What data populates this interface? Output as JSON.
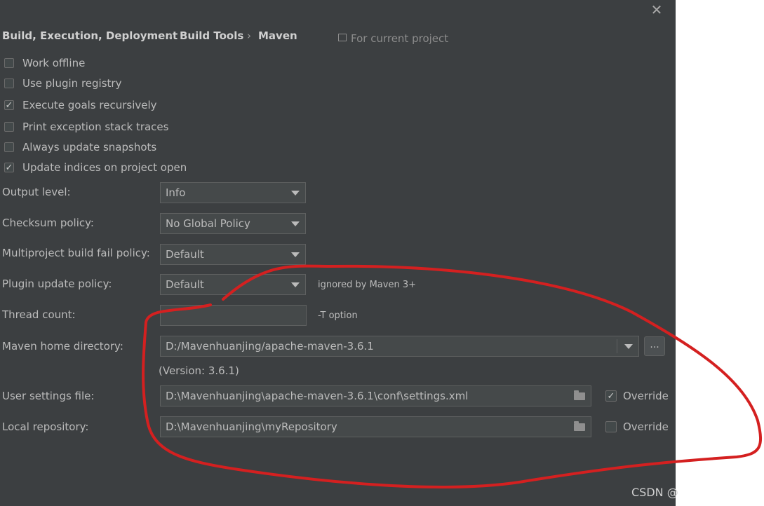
{
  "dialog": {
    "close_glyph": "✕"
  },
  "breadcrumb": {
    "items": [
      "Build, Execution, Deployment",
      "Build Tools",
      "Maven"
    ],
    "separator": "›"
  },
  "scope": {
    "label": "For current project"
  },
  "checkboxes": [
    {
      "label": "Work offline",
      "checked": false
    },
    {
      "label": "Use plugin registry",
      "checked": false
    },
    {
      "label": "Execute goals recursively",
      "checked": true
    },
    {
      "label": "Print exception stack traces",
      "checked": false
    },
    {
      "label": "Always update snapshots",
      "checked": false
    },
    {
      "label": "Update indices on project open",
      "checked": true
    }
  ],
  "settings": {
    "output_level": {
      "label": "Output level:",
      "value": "Info"
    },
    "checksum_policy": {
      "label": "Checksum policy:",
      "value": "No Global Policy"
    },
    "multiproject_policy": {
      "label": "Multiproject build fail policy:",
      "value": "Default"
    },
    "plugin_update_policy": {
      "label": "Plugin update policy:",
      "value": "Default",
      "hint": "ignored by Maven 3+"
    },
    "thread_count": {
      "label": "Thread count:",
      "value": "",
      "hint": "-T option"
    },
    "maven_home": {
      "label": "Maven home directory:",
      "value": "D:/Mavenhuanjing/apache-maven-3.6.1",
      "version": "(Version: 3.6.1)",
      "browse_label": "..."
    },
    "user_settings": {
      "label": "User settings file:",
      "value": "D:\\Mavenhuanjing\\apache-maven-3.6.1\\conf\\settings.xml",
      "override_label": "Override",
      "override_checked": true
    },
    "local_repository": {
      "label": "Local repository:",
      "value": "D:\\Mavenhuanjing\\myRepository",
      "override_label": "Override",
      "override_checked": false
    }
  },
  "watermark": {
    "text": "CSDN @"
  },
  "annotation": {
    "color": "#d42020"
  },
  "check_glyph": "✓"
}
